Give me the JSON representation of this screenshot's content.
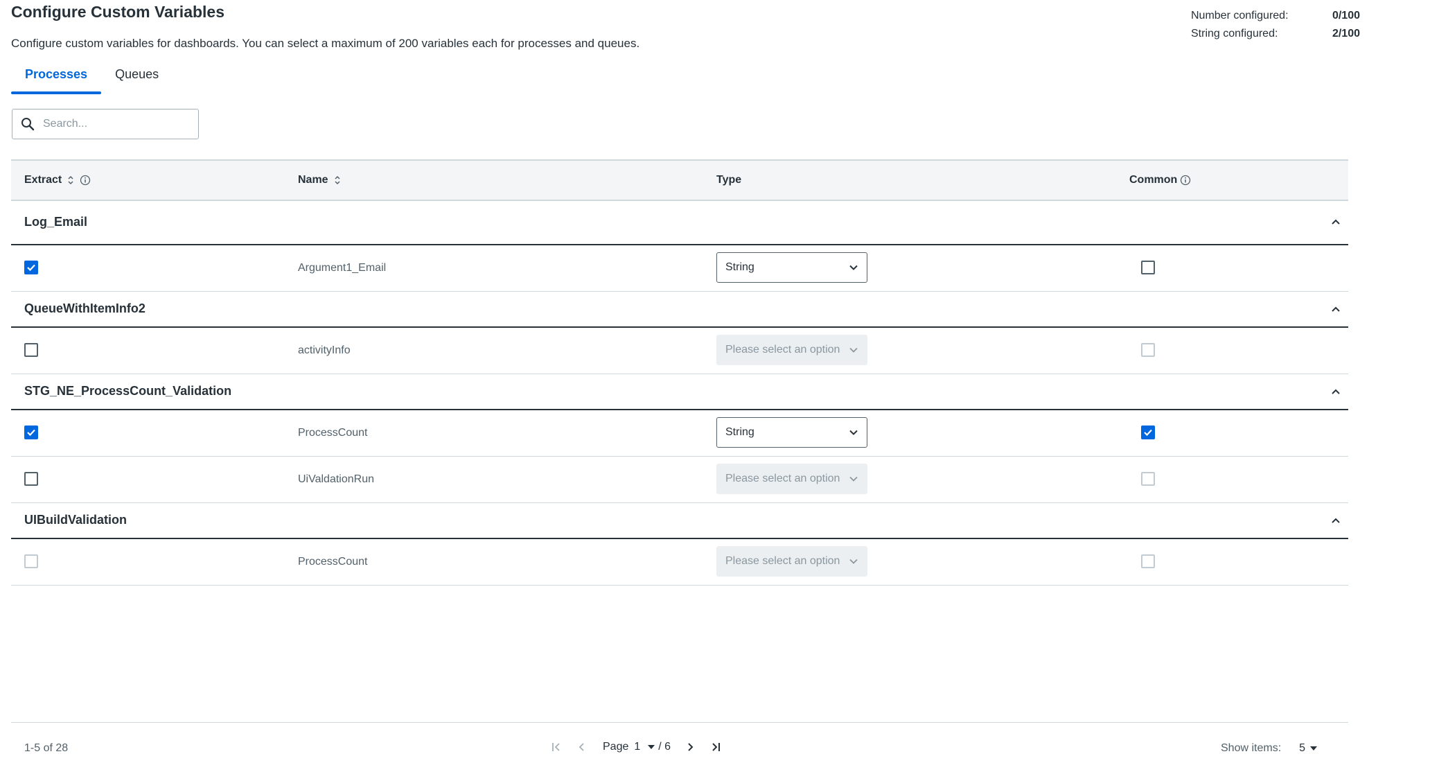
{
  "header": {
    "title": "Configure Custom Variables",
    "subtitle": "Configure custom variables for dashboards. You can select a maximum of 200 variables each for processes and queues."
  },
  "counters": {
    "number_label": "Number configured:",
    "number_value": "0/100",
    "string_label": "String configured:",
    "string_value": "2/100"
  },
  "tabs": [
    {
      "label": "Processes",
      "active": true
    },
    {
      "label": "Queues",
      "active": false
    }
  ],
  "search": {
    "placeholder": "Search..."
  },
  "table": {
    "columns": {
      "extract": "Extract",
      "name": "Name",
      "type": "Type",
      "common": "Common"
    },
    "groups": [
      {
        "name": "Log_Email",
        "items": [
          {
            "name": "Argument1_Email",
            "extract": true,
            "type": "String",
            "common": false
          }
        ]
      },
      {
        "name": "QueueWithItemInfo2",
        "items": [
          {
            "name": "activityInfo",
            "extract": false,
            "type": "Please select an option",
            "common": false
          }
        ]
      },
      {
        "name": "STG_NE_ProcessCount_Validation",
        "items": [
          {
            "name": "ProcessCount",
            "extract": true,
            "type": "String",
            "common": true
          },
          {
            "name": "UiValdationRun",
            "extract": false,
            "type": "Please select an option",
            "common": false
          }
        ]
      },
      {
        "name": "UIBuildValidation",
        "items": [
          {
            "name": "ProcessCount",
            "extract": false,
            "type": "Please select an option",
            "common": false
          }
        ]
      }
    ]
  },
  "footer": {
    "range": "1-5 of 28",
    "page_label": "Page",
    "page_current": "1",
    "page_total": "/ 6",
    "show_items_label": "Show items:",
    "show_items_value": "5"
  },
  "colors": {
    "accent": "#0067df",
    "text": "#273139",
    "muted": "#526069",
    "disabled_bg": "#eceff1"
  }
}
